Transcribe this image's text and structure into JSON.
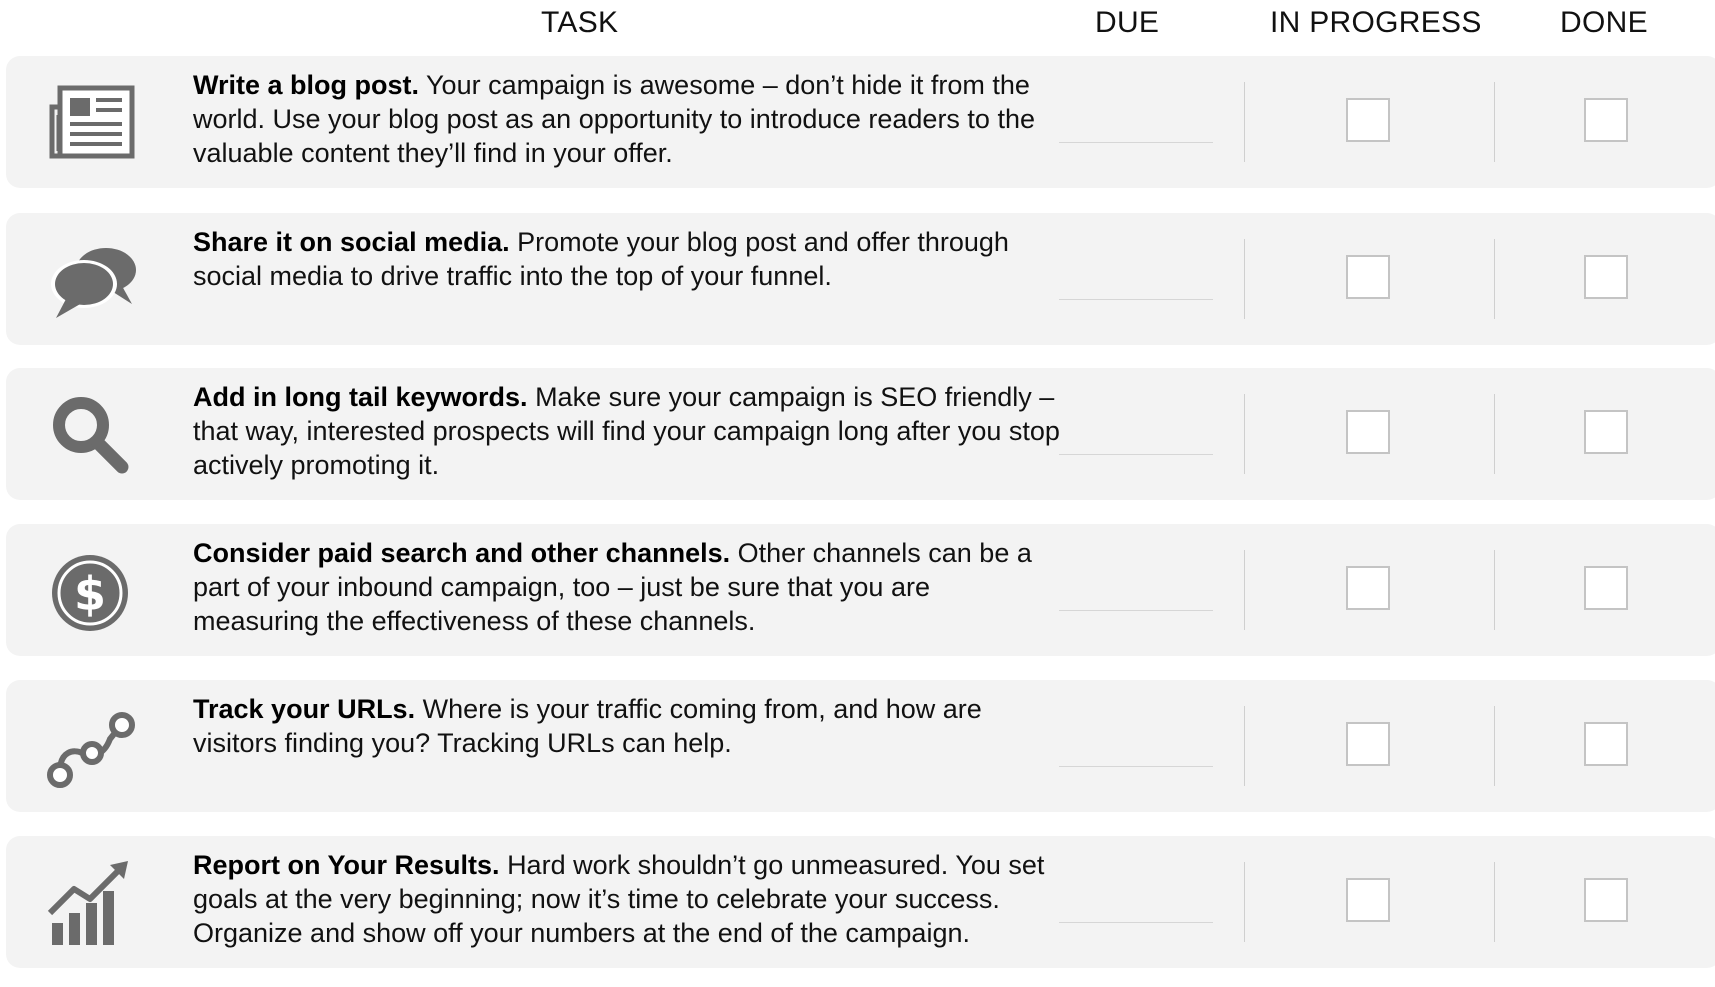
{
  "headers": {
    "task": "TASK",
    "due": "DUE",
    "in_progress": "IN PROGRESS",
    "done": "DONE"
  },
  "rows": [
    {
      "icon": "newspaper-icon",
      "title": "Write a blog post.",
      "description": "Your campaign is awesome – don’t hide it from the world. Use your blog post as an opportunity to introduce readers to the valuable content they’ll find in your offer.",
      "due": "",
      "in_progress": false,
      "done": false
    },
    {
      "icon": "speech-bubbles-icon",
      "title": "Share it on social media.",
      "description": "Promote your blog post and offer through social media to drive traffic into the top of your funnel.",
      "due": "",
      "in_progress": false,
      "done": false
    },
    {
      "icon": "magnifier-icon",
      "title": "Add in long tail keywords.",
      "description": "Make sure your campaign is SEO friendly – that way, interested prospects will find your campaign long after you stop actively promoting it.",
      "due": "",
      "in_progress": false,
      "done": false
    },
    {
      "icon": "dollar-coin-icon",
      "title": "Consider paid search and other channels.",
      "description": "Other channels can be a part of your inbound campaign, too – just be sure that you are measuring the effectiveness of these channels.",
      "due": "",
      "in_progress": false,
      "done": false
    },
    {
      "icon": "tracking-path-icon",
      "title": "Track your URLs.",
      "description": "Where is your traffic coming from, and how are visitors finding you? Tracking URLs can help.",
      "due": "",
      "in_progress": false,
      "done": false
    },
    {
      "icon": "growth-chart-icon",
      "title": "Report on Your Results.",
      "description": "Hard work shouldn’t go unmeasured. You set goals at the very beginning; now it’s time to celebrate your success. Organize and show off your numbers at the end of the campaign.",
      "due": "",
      "in_progress": false,
      "done": false
    }
  ],
  "colors": {
    "row_background": "#f3f3f3",
    "icon_gray": "#6b6b6b",
    "checkbox_border": "#c4c4c4"
  }
}
